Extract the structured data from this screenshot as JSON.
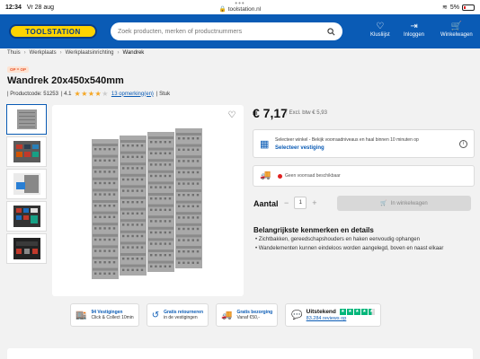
{
  "statusbar": {
    "time": "12:34",
    "date": "Vr 28 aug",
    "url": "toolstation.nl",
    "battery": "5%"
  },
  "header": {
    "logo_text": "TOOLSTATION",
    "search_placeholder": "Zoek producten, merken of productnummers",
    "items": [
      {
        "label": "Klusliijst",
        "icon": "heart-icon"
      },
      {
        "label": "Inloggen",
        "icon": "login-icon"
      },
      {
        "label": "Winkelwagen",
        "icon": "cart-icon"
      }
    ]
  },
  "breadcrumb": [
    "Thuis",
    "Werkplaats",
    "Werkplaatsinrichting",
    "Wandrek"
  ],
  "product": {
    "badge": "OP = OP",
    "title": "Wandrek 20x450x540mm",
    "code_label": "| Productcode: 51253",
    "rating_text": "| 4.1",
    "rating_value": 4.1,
    "reviews_text": "13 opmerking(en)",
    "unit_text": "| Stuk",
    "price": "€ 7,17",
    "price_ex": "Excl. btw € 5,93"
  },
  "store": {
    "line1": "Selecteer winkel - Bekijk voorraadniveaus en haal binnen 10 minuten op",
    "line2": "Selecteer vestiging"
  },
  "delivery": {
    "status": "Geen voorraad beschikbaar"
  },
  "quantity": {
    "label": "Aantal",
    "value": "1",
    "minus": "−",
    "plus": "+"
  },
  "cart_button": "In winkelwagen",
  "features": {
    "title": "Belangrijkste kenmerken en details",
    "items": [
      "Zichtbakken, gereedschapshouders en haken eenvoudig ophangen",
      "Wandelementen kunnen eindeloos worden aangelegd, boven en naast elkaar"
    ]
  },
  "usps": [
    {
      "title": "94 Vestigingen",
      "sub": "Click & Collect 10min",
      "icon": "store-icon"
    },
    {
      "title": "Gratis retourneren",
      "sub": "in de vestigingen",
      "icon": "return-icon"
    },
    {
      "title": "Gratis bezorging",
      "sub": "Vanaf €50,-",
      "icon": "truck-icon"
    }
  ],
  "trustpilot": {
    "label": "Uitstekend",
    "reviews": "83.284 reviews op",
    "score_stars": 4.5
  },
  "colors": {
    "brand_blue": "#0a5bb5",
    "logo_yellow": "#ffd400",
    "trustpilot_green": "#00b67a"
  }
}
